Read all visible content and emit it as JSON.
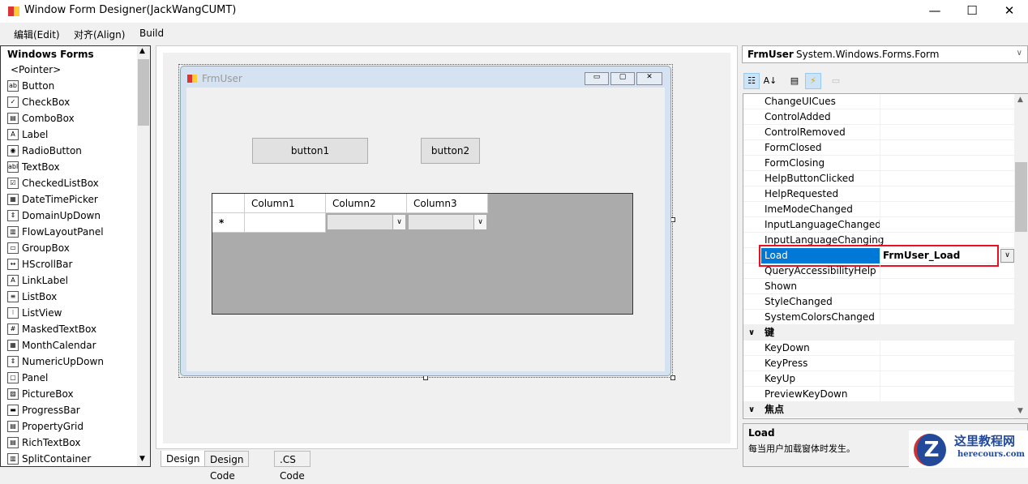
{
  "window": {
    "title": "Window Form Designer(JackWangCUMT)",
    "minimize": "—",
    "maximize": "☐",
    "close": "✕"
  },
  "menu": [
    "编辑(Edit)",
    "对齐(Align)",
    "Build"
  ],
  "toolbox": {
    "header": "Windows Forms",
    "items": [
      {
        "label": "<Pointer>",
        "icon": ""
      },
      {
        "label": "Button",
        "icon": "ab"
      },
      {
        "label": "CheckBox",
        "icon": "✓"
      },
      {
        "label": "ComboBox",
        "icon": "▤"
      },
      {
        "label": "Label",
        "icon": "A"
      },
      {
        "label": "RadioButton",
        "icon": "◉"
      },
      {
        "label": "TextBox",
        "icon": "abl"
      },
      {
        "label": "CheckedListBox",
        "icon": "☑"
      },
      {
        "label": "DateTimePicker",
        "icon": "▦"
      },
      {
        "label": "DomainUpDown",
        "icon": "⇕"
      },
      {
        "label": "FlowLayoutPanel",
        "icon": "▥"
      },
      {
        "label": "GroupBox",
        "icon": "▭"
      },
      {
        "label": "HScrollBar",
        "icon": "↔"
      },
      {
        "label": "LinkLabel",
        "icon": "A"
      },
      {
        "label": "ListBox",
        "icon": "≡"
      },
      {
        "label": "ListView",
        "icon": "⁝"
      },
      {
        "label": "MaskedTextBox",
        "icon": "#"
      },
      {
        "label": "MonthCalendar",
        "icon": "▦"
      },
      {
        "label": "NumericUpDown",
        "icon": "⇕"
      },
      {
        "label": "Panel",
        "icon": "▢"
      },
      {
        "label": "PictureBox",
        "icon": "▨"
      },
      {
        "label": "ProgressBar",
        "icon": "▬"
      },
      {
        "label": "PropertyGrid",
        "icon": "▤"
      },
      {
        "label": "RichTextBox",
        "icon": "▤"
      },
      {
        "label": "SplitContainer",
        "icon": "▥"
      }
    ]
  },
  "designer": {
    "form_title": "FrmUser",
    "button1": "button1",
    "button2": "button2",
    "grid": {
      "columns": [
        "Column1",
        "Column2",
        "Column3"
      ],
      "new_row_marker": "*"
    }
  },
  "tabs": [
    "Design",
    "Design Code",
    ".CS Code"
  ],
  "properties": {
    "object_name": "FrmUser",
    "object_type": "System.Windows.Forms.Form",
    "rows": [
      {
        "name": "ChangeUICues"
      },
      {
        "name": "ControlAdded"
      },
      {
        "name": "ControlRemoved"
      },
      {
        "name": "FormClosed"
      },
      {
        "name": "FormClosing"
      },
      {
        "name": "HelpButtonClicked"
      },
      {
        "name": "HelpRequested"
      },
      {
        "name": "ImeModeChanged"
      },
      {
        "name": "InputLanguageChanged"
      },
      {
        "name": "InputLanguageChanging"
      },
      {
        "name": "Load",
        "value": "FrmUser_Load",
        "selected": true
      },
      {
        "name": "QueryAccessibilityHelp"
      },
      {
        "name": "Shown"
      },
      {
        "name": "StyleChanged"
      },
      {
        "name": "SystemColorsChanged"
      },
      {
        "name": "键",
        "category": true
      },
      {
        "name": "KeyDown"
      },
      {
        "name": "KeyPress"
      },
      {
        "name": "KeyUp"
      },
      {
        "name": "PreviewKeyDown"
      },
      {
        "name": "焦点",
        "category": true
      }
    ],
    "description_title": "Load",
    "description_text": "每当用户加载窗体时发生。"
  },
  "watermark": {
    "title": "这里教程网",
    "url": "herecours.com"
  },
  "colors": {
    "selection": "#0078d7",
    "highlight_box": "#e81123",
    "grid_bg": "#ababab"
  }
}
